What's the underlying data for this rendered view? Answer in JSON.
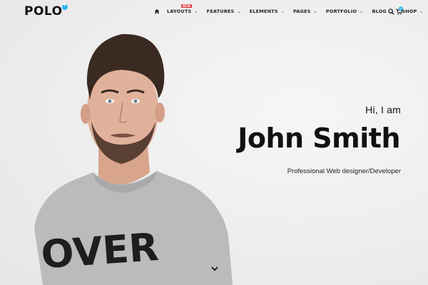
{
  "brand": {
    "name": "POLO",
    "accent": "#2fb3f5"
  },
  "nav": {
    "home_icon": "home-icon",
    "items": [
      {
        "label": "LAYOUTS",
        "badge": "NEW"
      },
      {
        "label": "FEATURES"
      },
      {
        "label": "ELEMENTS"
      },
      {
        "label": "PAGES"
      },
      {
        "label": "PORTFOLIO"
      },
      {
        "label": "BLOG"
      },
      {
        "label": "SHOP"
      }
    ],
    "cart_count": "0"
  },
  "hero": {
    "greeting": "Hi, I am",
    "name": "John Smith",
    "role": "Professional Web designer/Developer",
    "shirt_text": "OVER"
  }
}
